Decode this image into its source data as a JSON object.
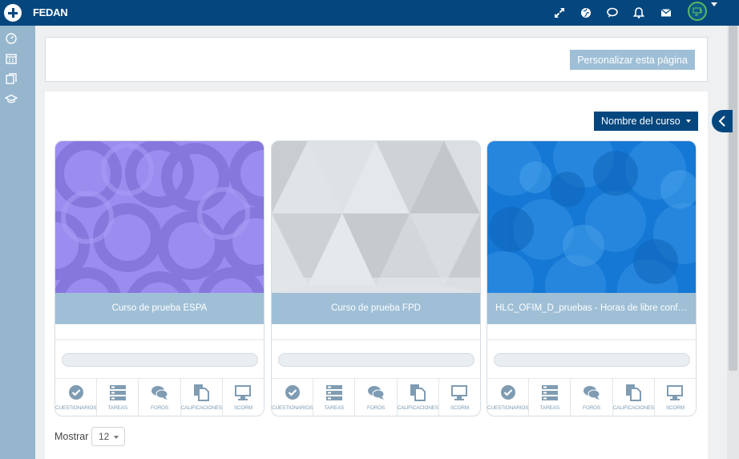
{
  "app": {
    "brand": "FEDAN"
  },
  "colors": {
    "navbar": "#04477e",
    "drawer": "#96b6ce",
    "title_bar": "#9fbfd6",
    "accent_icons": "#7f9cb3"
  },
  "topbar_icons": [
    "fullscreen-icon",
    "globe-icon",
    "messages-icon",
    "bell-icon",
    "mail-icon",
    "user-avatar"
  ],
  "drawer_icons": [
    "dashboard-icon",
    "calendar-icon",
    "courses-icon",
    "graduation-cap-icon"
  ],
  "header": {
    "customize_label": "Personalizar esta página"
  },
  "toolbar": {
    "sort_label": "Nombre del curso"
  },
  "cards": [
    {
      "title": "Curso de prueba ESPA",
      "pattern": "purple-circles"
    },
    {
      "title": "Curso de prueba FPD",
      "pattern": "gray-triangles"
    },
    {
      "title": "HLC_OFIM_D_pruebas - Horas de libre configuración",
      "pattern": "blue-circles"
    }
  ],
  "activity_labels": [
    "CUESTIONARIOS",
    "TAREAS",
    "FOROS",
    "CALIFICACIONES",
    "SCORM"
  ],
  "pager": {
    "show_label": "Mostrar",
    "per_page": "12"
  }
}
